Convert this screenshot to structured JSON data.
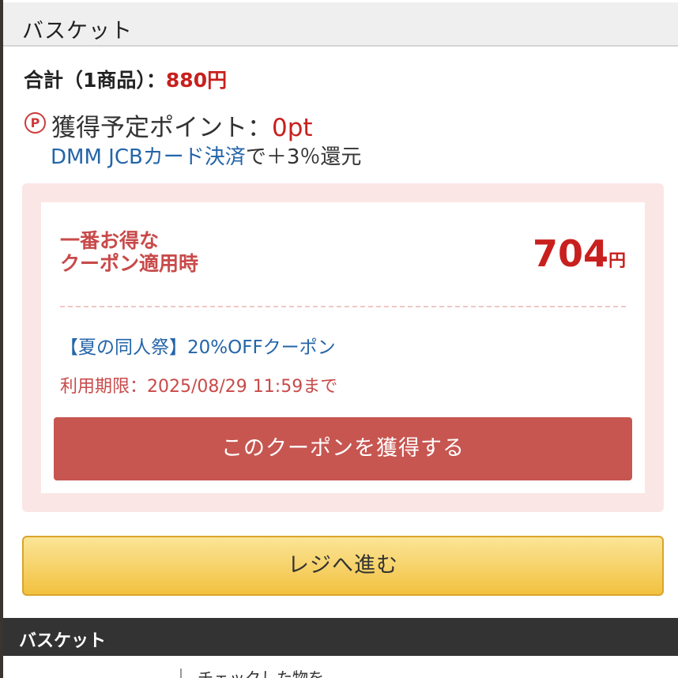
{
  "header": {
    "title": "バスケット"
  },
  "summary": {
    "total_label": "合計（1商品）：",
    "total_amount": "880円",
    "points_icon": "Ⓟ",
    "points_label": "獲得予定ポイント：",
    "points_value": "0pt",
    "jcb_link": "DMM JCBカード決済",
    "jcb_suffix": "で＋3％還元"
  },
  "coupon": {
    "best_line1": "一番お得な",
    "best_line2": "クーポン適用時",
    "price": "704",
    "price_unit": "円",
    "name": "【夏の同人祭】20%OFFクーポン",
    "expire": "利用期限：2025/08/29 11:59まで",
    "button_label": "このクーポンを獲得する"
  },
  "checkout": {
    "button_label": "レジへ進む"
  },
  "basket_section": {
    "title": "バスケット",
    "cutoff_text": "チェックした物を"
  },
  "colors": {
    "accent_red": "#c8201e",
    "coupon_button": "#c75651",
    "checkout_button": "#f2c13f",
    "link_blue": "#2465a8",
    "coupon_bg": "#fbe6e6"
  },
  "icons": {
    "points": "point-p-icon"
  }
}
